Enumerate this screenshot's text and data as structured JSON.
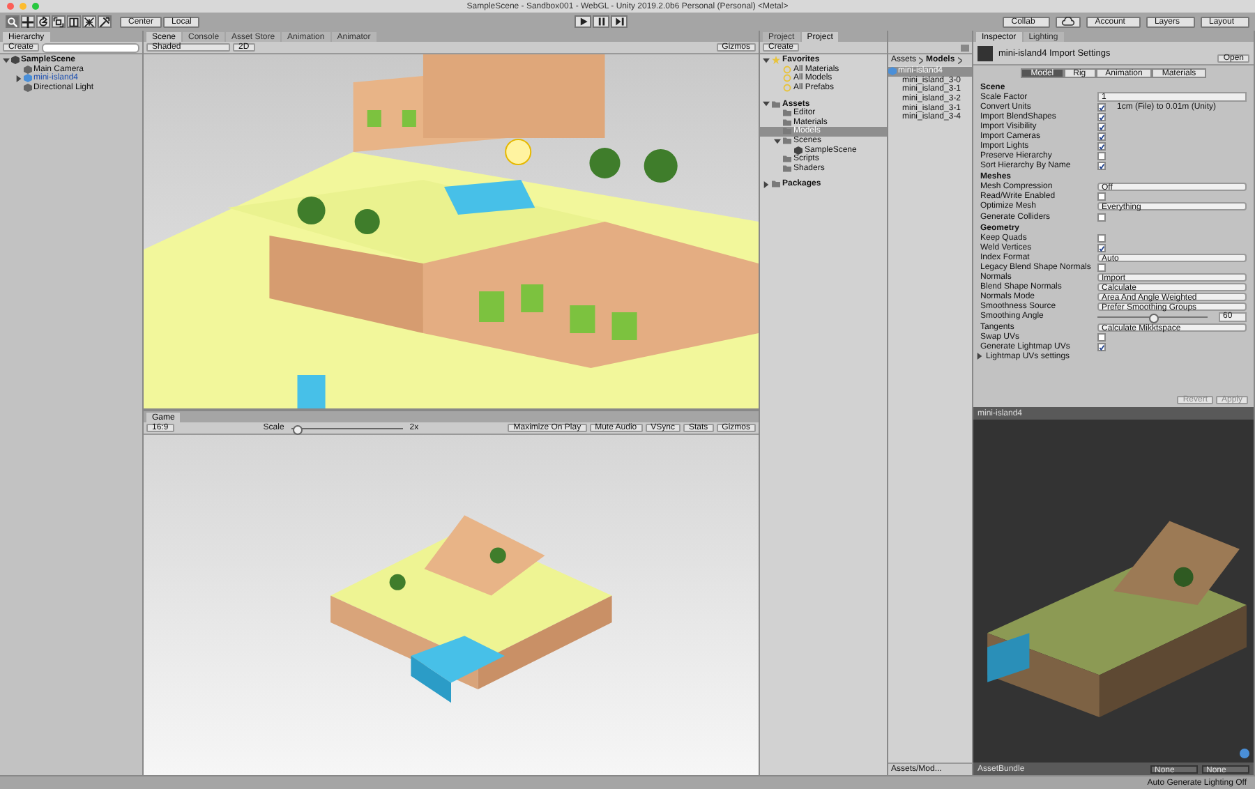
{
  "window": {
    "title": "SampleScene - Sandbox001 - WebGL - Unity 2019.2.0b6 Personal (Personal) <Metal>"
  },
  "toolbar": {
    "tools": [
      {
        "kind": "hand",
        "selected": true
      },
      {
        "kind": "move",
        "selected": false
      },
      {
        "kind": "rotate",
        "selected": false
      },
      {
        "kind": "scale",
        "selected": false
      },
      {
        "kind": "rect",
        "selected": false
      },
      {
        "kind": "transform",
        "selected": false
      },
      {
        "kind": "custom",
        "selected": false
      }
    ],
    "pivot": [
      "Center",
      "Local"
    ],
    "collab": "Collab",
    "account": "Account",
    "layers": "Layers",
    "layout": "Layout"
  },
  "hierarchy": {
    "tab": "Hierarchy",
    "create": "Create",
    "items": [
      {
        "label": "SampleScene",
        "kind": "scene",
        "expanded": true,
        "selected": false,
        "children": [
          {
            "label": "Main Camera",
            "kind": "object",
            "selected": false
          },
          {
            "label": "mini-island4",
            "kind": "prefab",
            "expanded": false,
            "selected": false
          },
          {
            "label": "Directional Light",
            "kind": "object",
            "selected": false
          }
        ]
      }
    ]
  },
  "scene": {
    "tabs": [
      {
        "label": "Scene",
        "selected": true
      },
      {
        "label": "Console",
        "selected": false
      },
      {
        "label": "Asset Store",
        "selected": false
      },
      {
        "label": "Animation",
        "selected": false
      },
      {
        "label": "Animator",
        "selected": false
      }
    ],
    "shading": "Shaded",
    "mode_2d": "2D",
    "gizmos": "Gizmos"
  },
  "game": {
    "tab": "Game",
    "display": "16:9",
    "scale": {
      "label": "Scale",
      "level": 0.05,
      "value": "2x"
    },
    "toggles": [
      "Maximize On Play",
      "Mute Audio",
      "VSync",
      "Stats"
    ],
    "gizmos": "Gizmos"
  },
  "project": {
    "tabs": [
      {
        "label": "Project",
        "selected": false
      },
      {
        "label": "Project",
        "selected": true
      }
    ],
    "create": "Create",
    "tree": [
      {
        "label": "Favorites",
        "kind": "favorites",
        "expanded": true,
        "selected": false,
        "children": [
          {
            "label": "All Materials",
            "kind": "search",
            "selected": false
          },
          {
            "label": "All Models",
            "kind": "search",
            "selected": false
          },
          {
            "label": "All Prefabs",
            "kind": "search",
            "selected": false
          }
        ]
      },
      {
        "label": "Assets",
        "kind": "folder",
        "expanded": true,
        "selected": false,
        "children": [
          {
            "label": "Editor",
            "kind": "folder",
            "selected": false
          },
          {
            "label": "Materials",
            "kind": "folder",
            "selected": false
          },
          {
            "label": "Models",
            "kind": "folder",
            "selected": true
          },
          {
            "label": "Scenes",
            "kind": "folder",
            "expanded": true,
            "selected": false,
            "children": [
              {
                "label": "SampleScene",
                "kind": "scene",
                "selected": false
              }
            ]
          },
          {
            "label": "Scripts",
            "kind": "folder",
            "selected": false
          },
          {
            "label": "Shaders",
            "kind": "folder",
            "selected": false
          }
        ]
      },
      {
        "label": "Packages",
        "kind": "folder",
        "expanded": false,
        "selected": false
      }
    ],
    "breadcrumb": [
      "Assets",
      "Models"
    ],
    "files": [
      {
        "label": "mini-island4",
        "kind": "model",
        "selected": true
      },
      {
        "label": "mini_island_3-0",
        "kind": "mesh",
        "selected": false
      },
      {
        "label": "mini_island_3-1",
        "kind": "mesh",
        "selected": false
      },
      {
        "label": "mini_island_3-2",
        "kind": "mesh",
        "selected": false
      },
      {
        "label": "mini_island_3-1",
        "kind": "mesh",
        "selected": false
      },
      {
        "label": "mini_island_3-4",
        "kind": "mesh",
        "selected": false
      }
    ],
    "path": "Assets/Mod..."
  },
  "inspector": {
    "tabs": [
      {
        "label": "Inspector",
        "selected": true
      },
      {
        "label": "Lighting",
        "selected": false
      }
    ],
    "title": "mini-island4 Import Settings",
    "open": "Open",
    "subtabs": [
      {
        "label": "Model",
        "selected": true
      },
      {
        "label": "Rig",
        "selected": false
      },
      {
        "label": "Animation",
        "selected": false
      },
      {
        "label": "Materials",
        "selected": false
      }
    ],
    "sections": [
      {
        "title": "Scene",
        "rows": [
          {
            "kind": "field",
            "label": "Scale Factor",
            "value": "1"
          },
          {
            "kind": "checkbox",
            "label": "Convert Units",
            "checked": true,
            "note": "1cm (File) to 0.01m (Unity)"
          },
          {
            "kind": "checkbox",
            "label": "Import BlendShapes",
            "checked": true
          },
          {
            "kind": "checkbox",
            "label": "Import Visibility",
            "checked": true
          },
          {
            "kind": "checkbox",
            "label": "Import Cameras",
            "checked": true
          },
          {
            "kind": "checkbox",
            "label": "Import Lights",
            "checked": true
          },
          {
            "kind": "checkbox",
            "label": "Preserve Hierarchy",
            "checked": false
          },
          {
            "kind": "checkbox",
            "label": "Sort Hierarchy By Name",
            "checked": true
          }
        ]
      },
      {
        "title": "Meshes",
        "rows": [
          {
            "kind": "dropdown",
            "label": "Mesh Compression",
            "value": "Off"
          },
          {
            "kind": "checkbox",
            "label": "Read/Write Enabled",
            "checked": false
          },
          {
            "kind": "dropdown",
            "label": "Optimize Mesh",
            "value": "Everything"
          },
          {
            "kind": "checkbox",
            "label": "Generate Colliders",
            "checked": false
          }
        ]
      },
      {
        "title": "Geometry",
        "rows": [
          {
            "kind": "checkbox",
            "label": "Keep Quads",
            "checked": false
          },
          {
            "kind": "checkbox",
            "label": "Weld Vertices",
            "checked": true
          },
          {
            "kind": "dropdown",
            "label": "Index Format",
            "value": "Auto"
          },
          {
            "kind": "checkbox",
            "label": "Legacy Blend Shape Normals",
            "checked": false
          },
          {
            "kind": "dropdown",
            "label": "Normals",
            "value": "Import"
          },
          {
            "kind": "dropdown",
            "label": "Blend Shape Normals",
            "value": "Calculate"
          },
          {
            "kind": "dropdown",
            "label": "Normals Mode",
            "value": "Area And Angle Weighted"
          },
          {
            "kind": "dropdown",
            "label": "Smoothness Source",
            "value": "Prefer Smoothing Groups"
          },
          {
            "kind": "slider",
            "label": "Smoothing Angle",
            "level": 0.5,
            "reading": "60"
          },
          {
            "kind": "dropdown",
            "label": "Tangents",
            "value": "Calculate Mikktspace"
          },
          {
            "kind": "checkbox",
            "label": "Swap UVs",
            "checked": false
          },
          {
            "kind": "checkbox",
            "label": "Generate Lightmap UVs",
            "checked": true
          }
        ]
      }
    ],
    "foldout": {
      "label": "Lightmap UVs settings",
      "expanded": false
    },
    "buttons": [
      {
        "label": "Revert",
        "disabled": true
      },
      {
        "label": "Apply",
        "disabled": true
      }
    ]
  },
  "preview": {
    "title": "mini-island4",
    "asset_bundle": "AssetBundle",
    "bundle_values": [
      "None",
      "None"
    ]
  },
  "status_bar": {
    "text": "Auto Generate Lighting Off"
  }
}
